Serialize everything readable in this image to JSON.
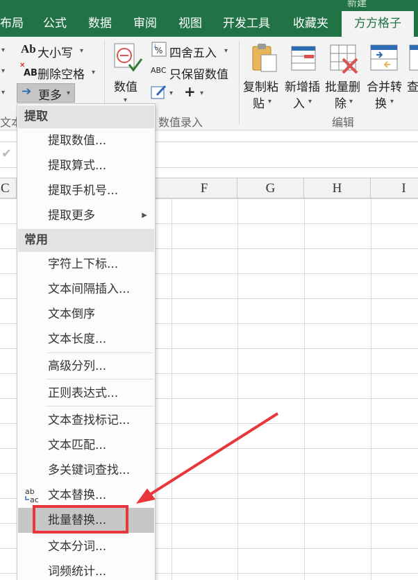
{
  "titlebar": {
    "title": "新建"
  },
  "tabs": [
    {
      "label": "布局"
    },
    {
      "label": "公式"
    },
    {
      "label": "数据"
    },
    {
      "label": "审阅"
    },
    {
      "label": "视图"
    },
    {
      "label": "开发工具"
    },
    {
      "label": "收藏夹"
    },
    {
      "label": "方方格子",
      "active": true
    }
  ],
  "ribbon": {
    "text_group": {
      "case_label": "大小写",
      "remove_space_label": "删除空格",
      "more_label": "更多",
      "group_label_partial": "文本"
    },
    "number_group": {
      "number_label": "数值",
      "round_label": "四舍五入",
      "keep_number_label": "只保留数值",
      "group_label": "数值录入"
    },
    "edit_group": {
      "copy_paste": [
        "复制粘",
        "贴"
      ],
      "insert": [
        "新增插",
        "入"
      ],
      "batch_delete": [
        "批量删",
        "除"
      ],
      "merge": [
        "合并转",
        "换"
      ],
      "partial_last": "查",
      "group_label": "编辑"
    }
  },
  "sheet": {
    "columns": [
      "C",
      "F",
      "G",
      "H",
      "I"
    ]
  },
  "menu": {
    "sections": [
      {
        "header": "提取",
        "items": [
          "提取数值...",
          "提取算式...",
          "提取手机号...",
          "提取更多"
        ]
      },
      {
        "header": "常用",
        "items": [
          "字符上下标...",
          "文本间隔插入...",
          "文本倒序",
          "文本长度...",
          "高级分列...",
          "正则表达式...",
          "文本查找标记...",
          "文本匹配...",
          "多关键词查找...",
          "文本替换...",
          "批量替换...",
          "文本分词...",
          "词频统计..."
        ]
      }
    ],
    "highlighted_item": "批量替换...",
    "submenu_arrow": "▶"
  },
  "colors": {
    "excel_green": "#217346",
    "annotation_red": "#e8363a",
    "menu_hover": "#c6c6c6"
  }
}
